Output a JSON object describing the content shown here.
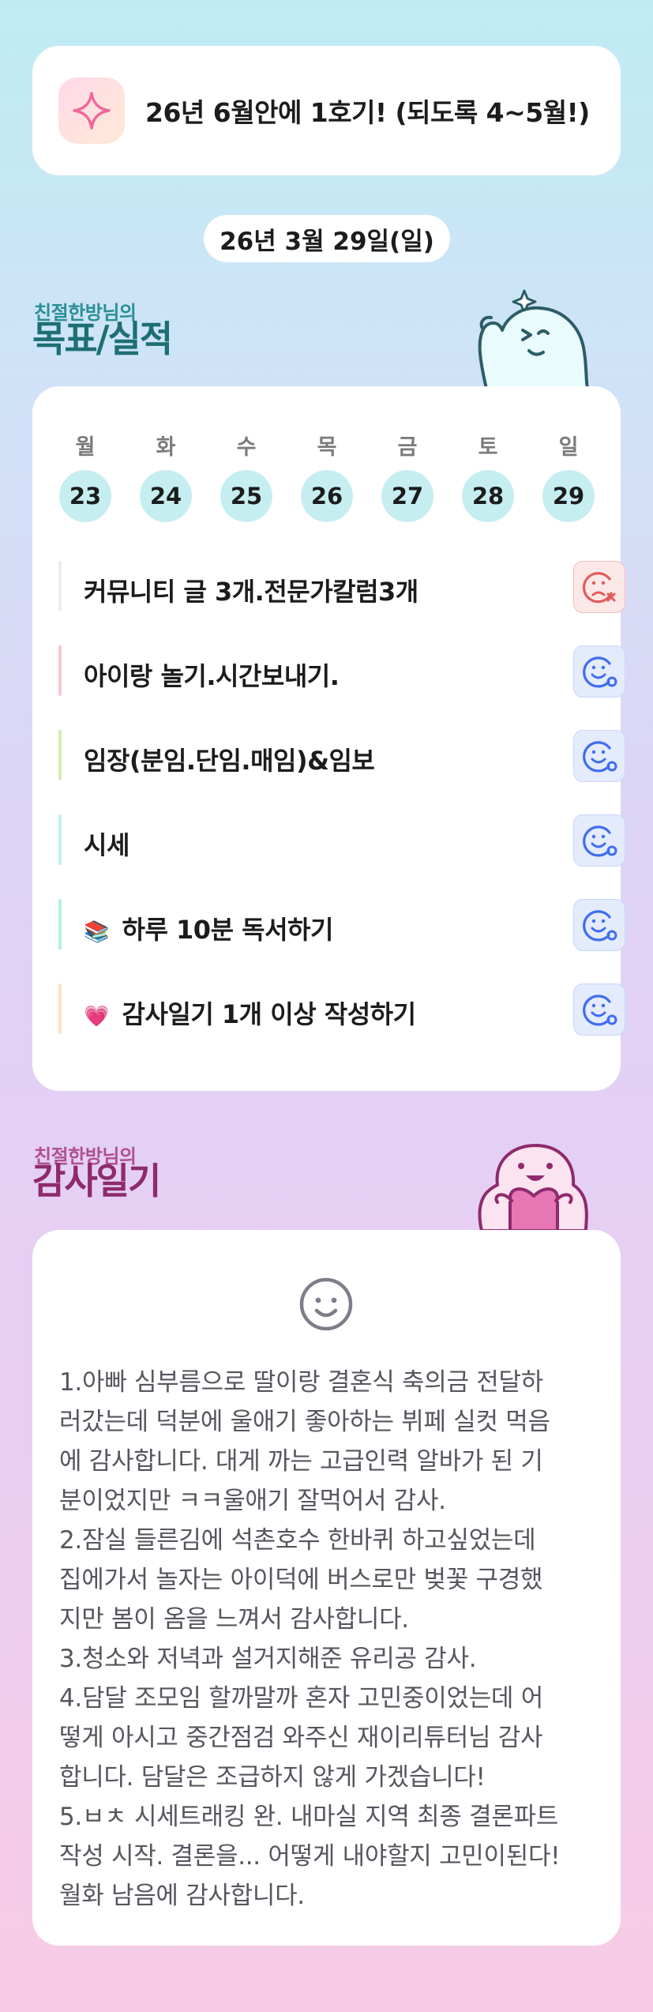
{
  "goal_banner": {
    "icon": "sparkle-icon",
    "text": "26년 6월안에 1호기! (되도록 4~5월!)"
  },
  "date_label": "26년 3월 29일(일)",
  "goals_section": {
    "owner_label": "친절한방님의",
    "title": "목표/실적",
    "owner_color": "#2a8f95",
    "title_color": "#1d6f74"
  },
  "week": {
    "days": [
      "월",
      "화",
      "수",
      "목",
      "금",
      "토",
      "일"
    ],
    "dates": [
      "23",
      "24",
      "25",
      "26",
      "27",
      "28",
      "29"
    ]
  },
  "tasks": [
    {
      "emoji": "",
      "label": "커뮤니티 글 3개.전문가칼럼3개",
      "bar_color": "#eeeeee",
      "status": "fail"
    },
    {
      "emoji": "",
      "label": "아이랑 놀기.시간보내기.",
      "bar_color": "#f8c7cf",
      "status": "done"
    },
    {
      "emoji": "",
      "label": "임장(분임.단임.매임)&임보",
      "bar_color": "#d6ecb2",
      "status": "done"
    },
    {
      "emoji": "",
      "label": "시세",
      "bar_color": "#bfeef1",
      "status": "done"
    },
    {
      "emoji": "📚",
      "label": "하루 10분 독서하기",
      "bar_color": "#b7efe3",
      "status": "done"
    },
    {
      "emoji": "💗",
      "label": "감사일기 1개 이상 작성하기",
      "bar_color": "#fbe2c6",
      "status": "done"
    }
  ],
  "diary_section": {
    "owner_label": "친절한방님의",
    "title": "감사일기",
    "owner_color": "#b0508f",
    "title_color": "#8e2a6d",
    "mood_icon": "smile-face-icon",
    "lines": [
      "1.아빠 심부름으로 딸이랑 결혼식 축의금 전달하",
      "러갔는데 덕분에 울애기 좋아하는 뷔페 실컷 먹음",
      "에 감사합니다. 대게 까는 고급인력 알바가 된 기",
      "분이었지만 ㅋㅋ울애기 잘먹어서 감사.",
      "2.잠실 들른김에 석촌호수 한바퀴 하고싶었는데",
      "집에가서 놀자는 아이덕에 버스로만 벚꽃 구경했",
      "지만 봄이 옴을 느껴서 감사합니다.",
      "3.청소와 저녁과 설거지해준 유리공 감사.",
      "4.담달 조모임 할까말까 혼자 고민중이었는데 어",
      "떻게 아시고 중간점검 와주신 재이리튜터님 감사",
      "합니다. 담달은 조급하지 않게 가겠습니다!",
      "5.ㅂㅊ 시세트래킹 완. 내마실 지역 최종 결론파트",
      "작성 시작. 결론을... 어떻게 내야할지 고민이된다!",
      "월화 남음에 감사합니다."
    ]
  },
  "colors": {
    "fail_icon": "#e25b5b",
    "done_icon": "#3f6df0",
    "date_circle": "#c6eef1"
  }
}
